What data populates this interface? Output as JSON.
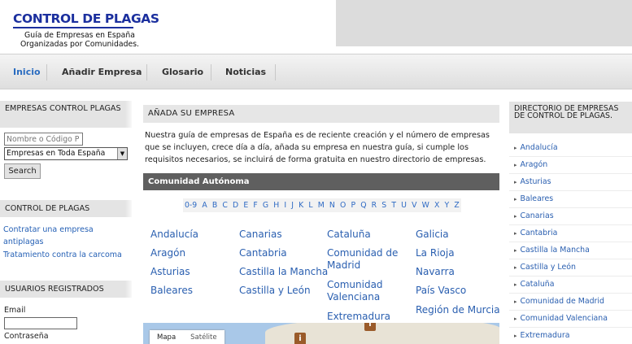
{
  "header": {
    "logo": "CONTROL DE PLAGAS",
    "tagline_1": "Guía de Empresas en España",
    "tagline_2": "Organizadas por Comunidades."
  },
  "nav": {
    "items": [
      "Inicio",
      "Añadir Empresa",
      "Glosario",
      "Noticias"
    ],
    "active": "Inicio"
  },
  "left_sidebar": {
    "search_box": {
      "title": "EMPRESAS CONTROL PLAGAS",
      "name_placeholder": "Nombre o Código P",
      "region_value": "Empresas en Toda España",
      "search_label": "Search"
    },
    "plagas_box": {
      "title": "CONTROL DE PLAGAS",
      "links": [
        "Contratar una empresa antiplagas",
        "Tratamiento contra la carcoma"
      ]
    },
    "users_box": {
      "title": "USUARIOS REGISTRADOS",
      "email_label": "Email",
      "password_label": "Contraseña"
    }
  },
  "main": {
    "title": "AÑADA SU EMPRESA",
    "intro": "Nuestra guía de empresas de España es de reciente creación y el número de empresas que se incluyen, crece día a día, añada su empresa en nuestra guía, si cumple los requisitos necesarios, se incluirá de forma gratuita en nuestro directorio de empresas.",
    "region_header": "Comunidad Autónoma",
    "alphabet": [
      "0-9",
      "A",
      "B",
      "C",
      "D",
      "E",
      "F",
      "G",
      "H",
      "I",
      "J",
      "K",
      "L",
      "M",
      "N",
      "O",
      "P",
      "Q",
      "R",
      "S",
      "T",
      "U",
      "V",
      "W",
      "X",
      "Y",
      "Z"
    ],
    "regions": {
      "col1": [
        "Andalucía",
        "Aragón",
        "Asturias",
        "Baleares"
      ],
      "col2": [
        "Canarias",
        "Cantabria",
        "Castilla la Mancha",
        "Castilla y León"
      ],
      "col3_a": "Cataluña",
      "col3_b": "Comunidad de Madrid",
      "col3_c": "Comunidad Valenciana",
      "col3_d": "Extremadura",
      "col4": [
        "Galicia",
        "La Rioja",
        "Navarra",
        "País Vasco",
        "Región de Murcia"
      ]
    },
    "map": {
      "tab_map": "Mapa",
      "tab_satellite": "Satélite",
      "marker_glyph": "i"
    }
  },
  "right_sidebar": {
    "title": "DIRECTORIO DE EMPRESAS DE CONTROL DE PLAGAS.",
    "items": [
      "Andalucía",
      "Aragón",
      "Asturias",
      "Baleares",
      "Canarias",
      "Cantabria",
      "Castilla la Mancha",
      "Castilla y León",
      "Cataluña",
      "Comunidad de Madrid",
      "Comunidad Valenciana",
      "Extremadura"
    ]
  },
  "colors": {
    "logo": "#1b2f9e",
    "link": "#2a5fb0",
    "region_header_bg": "#5f5f5f"
  }
}
